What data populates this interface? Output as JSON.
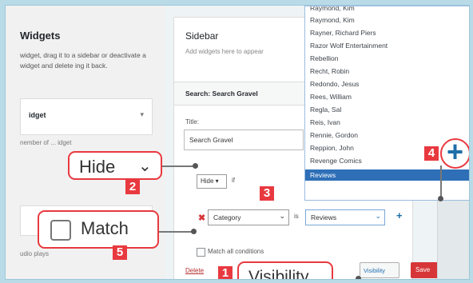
{
  "left_panel": {
    "title": "Widgets",
    "description": "widget, drag it to a sidebar or deactivate a widget and delete ing it back.",
    "widget_name": "idget",
    "widget_arrow": "▾",
    "widget_desc": "nember of ... idget",
    "footer": "udio plays"
  },
  "sidebar": {
    "title": "Sidebar",
    "subtitle": "Add widgets here to appear",
    "widget_header": "Search: Search Gravel",
    "title_label": "Title:",
    "title_value": "Search Gravel",
    "hide_select": "Hide ▾",
    "if_text": "if",
    "condition_x": "✖",
    "category_select": "Category",
    "is_text": "is",
    "value_select": "Reviews",
    "match_label": "Match all conditions",
    "delete_link": "Delete",
    "visibility_button": "Visibility",
    "save_button": "Save"
  },
  "dropdown_items": [
    "Raymond, Kim",
    "Raymond, Kim",
    "Rayner, Richard Piers",
    "Razor Wolf Entertainment",
    "Rebellion",
    "Recht, Robin",
    "Redondo, Jesus",
    "Rees, William",
    "Regla, Sal",
    "Reis, Ivan",
    "Rennie, Gordon",
    "Reppion, John",
    "Revenge Comics",
    "Reviews"
  ],
  "callouts": {
    "hide_text": "Hide",
    "hide_chevron": "⌄",
    "match_text": "Match",
    "visibility_text": "Visibility",
    "plus_text": "+",
    "badge_1": "1",
    "badge_2": "2",
    "badge_3": "3",
    "badge_4": "4",
    "badge_5": "5"
  },
  "colors": {
    "accent_red": "#e8393f",
    "link_blue": "#2271b1",
    "selected_blue": "#2e6fb7"
  }
}
